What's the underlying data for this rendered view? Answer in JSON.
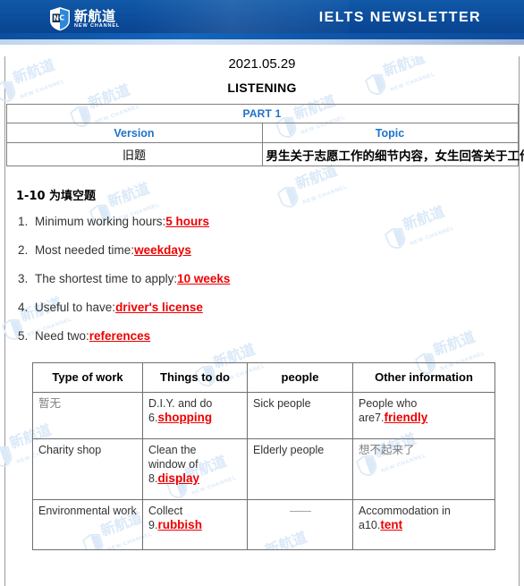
{
  "header": {
    "logo": {
      "shield_icon": "shield-nc-icon",
      "brand_cn": "新航道",
      "brand_en": "NEW CHANNEL"
    },
    "title": "IELTS  NEWSLETTER",
    "brand_blue": "#0c4d9c"
  },
  "doc": {
    "date": "2021.05.29",
    "section": "LISTENING"
  },
  "part_table": {
    "part_label": "PART 1",
    "columns": [
      "Version",
      "Topic"
    ],
    "rows": [
      {
        "version": "旧题",
        "topic": "男生关于志愿工作的细节内容，女生回答关于工作的细节和具体要求"
      }
    ],
    "header_color": "#1f72c8"
  },
  "questions": {
    "heading": "1-10 为填空题",
    "items": [
      {
        "num": "1.",
        "prompt": "Minimum working hours:",
        "answer": "5 hours"
      },
      {
        "num": "2.",
        "prompt": "Most needed time:",
        "answer": "weekdays"
      },
      {
        "num": "3.",
        "prompt": "The shortest time to apply:",
        "answer": "10 weeks"
      },
      {
        "num": "4.",
        "prompt": "Useful to have:",
        "answer": "driver's license"
      },
      {
        "num": "5.",
        "prompt": "Need two:",
        "answer": "references"
      }
    ],
    "answer_color": "#ee0000"
  },
  "work_table": {
    "columns": [
      "Type of work",
      "Things to do",
      "people",
      "Other information"
    ],
    "rows": [
      {
        "type": "暂无",
        "type_muted": true,
        "things_pre": "D.I.Y. and do\n6.",
        "things_answer": "shopping",
        "people": "Sick people",
        "people_muted": false,
        "other_pre": "People who\nare7.",
        "other_answer": "friendly"
      },
      {
        "type": "Charity shop",
        "type_muted": false,
        "things_pre": "Clean the\nwindow of\n8.",
        "things_answer": "display",
        "people": "Elderly people",
        "people_muted": false,
        "other_pre": "想不起来了",
        "other_answer": "",
        "other_muted": true
      },
      {
        "type": "Environmental work",
        "type_muted": false,
        "things_pre": "Collect\n9.",
        "things_answer": "rubbish",
        "people": "——",
        "people_muted": true,
        "other_pre": "Accommodation in\na10.",
        "other_answer": "tent"
      }
    ]
  },
  "watermark": {
    "brand_cn": "新航道",
    "brand_en": "NEW CHANNEL",
    "color": "#dbe9f8"
  }
}
